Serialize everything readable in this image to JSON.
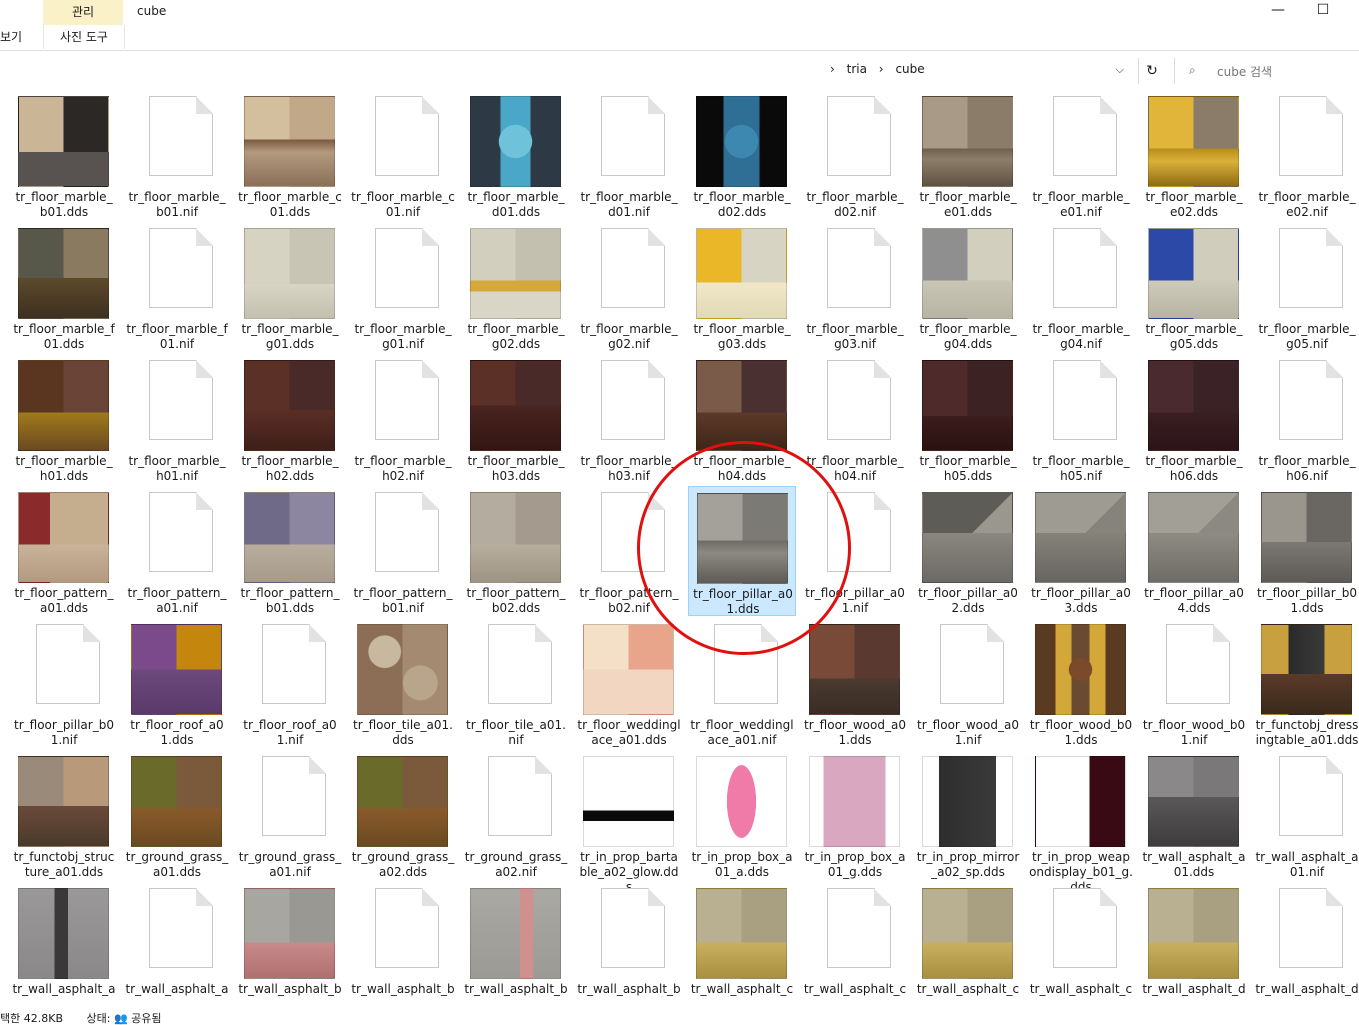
{
  "window": {
    "title": "cube",
    "minimize": "—",
    "maximize": "☐"
  },
  "ribbon": {
    "context_header": "관리",
    "context_tab": "사진 도구",
    "view_tab": "보기"
  },
  "address": {
    "crumbs": [
      "tria",
      "cube"
    ],
    "dropdown": "⌵",
    "refresh": "↻"
  },
  "search": {
    "placeholder": "cube 검색",
    "icon": "⌕"
  },
  "files": [
    {
      "name": "tr_floor_marble_b01.dds",
      "type": "img",
      "bg": "linear-gradient(to bottom,transparent 62%,#585250 62%),linear-gradient(to right,#cbb597 50%,#2c2825 50%)"
    },
    {
      "name": "tr_floor_marble_b01.nif",
      "type": "doc"
    },
    {
      "name": "tr_floor_marble_c01.dds",
      "type": "img",
      "bg": "linear-gradient(to bottom,transparent 48%,#7a5a40 48%,#b39a7e 62%,#8a7058 100%),linear-gradient(to right,#d3bf9e 50%,#c0a888 50%)"
    },
    {
      "name": "tr_floor_marble_c01.nif",
      "type": "doc"
    },
    {
      "name": "tr_floor_marble_d01.dds",
      "type": "img",
      "bg": "radial-gradient(circle at 50% 50%,#6ec3db 26%,transparent 27%),linear-gradient(to right,#2d3a45 33%,#4aa7c7 33%,#4aa7c7 67%,#2d3a45 67%)"
    },
    {
      "name": "tr_floor_marble_d01.nif",
      "type": "doc"
    },
    {
      "name": "tr_floor_marble_d02.dds",
      "type": "img",
      "bg": "radial-gradient(circle at 50% 50%,#3c88b0 26%,transparent 27%),linear-gradient(to right,#0a0a0a 30%,#2f6f95 30%,#2f6f95 70%,#0a0a0a 70%)"
    },
    {
      "name": "tr_floor_marble_d02.nif",
      "type": "doc"
    },
    {
      "name": "tr_floor_marble_e01.dds",
      "type": "img",
      "bg": "linear-gradient(to bottom,transparent 58%,#6e604e 58%,#8d7e6a 70%,#5e5242 100%),linear-gradient(to right,#a89a87 50%,#8a7c69 50%)"
    },
    {
      "name": "tr_floor_marble_e01.nif",
      "type": "doc"
    },
    {
      "name": "tr_floor_marble_e02.dds",
      "type": "img",
      "bg": "linear-gradient(to bottom,transparent 58%,#b88d1a 58%,#d9b13a 72%,#8e6c12 100%),linear-gradient(to right,#e0b53a 50%,#8a7c69 50%)"
    },
    {
      "name": "tr_floor_marble_e02.nif",
      "type": "doc"
    },
    {
      "name": "tr_floor_marble_f01.dds",
      "type": "img",
      "bg": "linear-gradient(to bottom,transparent 55%,#5d4a2c 55%,#3d3020 100%),linear-gradient(to right,#57574a 50%,#8a7a60 50%)"
    },
    {
      "name": "tr_floor_marble_f01.nif",
      "type": "doc"
    },
    {
      "name": "tr_floor_marble_g01.dds",
      "type": "img",
      "bg": "linear-gradient(to bottom,transparent 62%,#d8d5c6 62%,#c4c0b0 100%),linear-gradient(to right,#d6d3c3 50%,#c8c5b5 50%)"
    },
    {
      "name": "tr_floor_marble_g01.nif",
      "type": "doc"
    },
    {
      "name": "tr_floor_marble_g02.dds",
      "type": "img",
      "bg": "linear-gradient(to bottom,transparent 58%,#d4a83a 58%,#d4a83a 70%,#d9d6c7 70%),linear-gradient(to right,#d2cfbf 50%,#c3c0b0 50%)"
    },
    {
      "name": "tr_floor_marble_g02.nif",
      "type": "doc"
    },
    {
      "name": "tr_floor_marble_g03.dds",
      "type": "img",
      "bg": "linear-gradient(to bottom,transparent 60%,#f0e8c8 60%,#e2d9b5 100%),linear-gradient(to right,#e9b727 50%,#d8d4c3 50%)"
    },
    {
      "name": "tr_floor_marble_g03.nif",
      "type": "doc"
    },
    {
      "name": "tr_floor_marble_g04.dds",
      "type": "img",
      "bg": "linear-gradient(to bottom,transparent 58%,#c9c6b6 58%,#b8b4a3 100%),linear-gradient(to right,#8f8f8f 50%,#d2cfbf 50%)"
    },
    {
      "name": "tr_floor_marble_g04.nif",
      "type": "doc"
    },
    {
      "name": "tr_floor_marble_g05.dds",
      "type": "img",
      "bg": "linear-gradient(to bottom,transparent 58%,#cfcbbb 58%,#b8b4a3 100%),linear-gradient(to right,#2d49a8 50%,#d0cdbd 50%)"
    },
    {
      "name": "tr_floor_marble_g05.nif",
      "type": "doc"
    },
    {
      "name": "tr_floor_marble_h01.dds",
      "type": "img",
      "bg": "linear-gradient(to bottom,transparent 58%,#a07a1c 58%,#6b4a20 100%),linear-gradient(to right,#5a3520 50%,#6b4438 50%)"
    },
    {
      "name": "tr_floor_marble_h01.nif",
      "type": "doc"
    },
    {
      "name": "tr_floor_marble_h02.dds",
      "type": "img",
      "bg": "linear-gradient(to bottom,transparent 55%,#5a2e25 55%,#3e1f1a 100%),linear-gradient(to right,#5b3026 50%,#4a2a28 50%)"
    },
    {
      "name": "tr_floor_marble_h02.nif",
      "type": "doc"
    },
    {
      "name": "tr_floor_marble_h03.dds",
      "type": "img",
      "bg": "linear-gradient(to bottom,transparent 50%,#4a2420 50%,#321612 100%),linear-gradient(to right,#5b3026 50%,#4a2a28 50%)"
    },
    {
      "name": "tr_floor_marble_h03.nif",
      "type": "doc"
    },
    {
      "name": "tr_floor_marble_h04.dds",
      "type": "img",
      "bg": "linear-gradient(to bottom,transparent 58%,#5c3a28 58%,#3e2618 100%),linear-gradient(to right,#7a5a48 50%,#4a3030 50%)"
    },
    {
      "name": "tr_floor_marble_h04.nif",
      "type": "doc"
    },
    {
      "name": "tr_floor_marble_h05.dds",
      "type": "img",
      "bg": "linear-gradient(to bottom,transparent 62%,#3c1c1c 62%,#2a1212 100%),linear-gradient(to right,#4e2a2a 50%,#3c2222 50%)"
    },
    {
      "name": "tr_floor_marble_h05.nif",
      "type": "doc"
    },
    {
      "name": "tr_floor_marble_h06.dds",
      "type": "img",
      "bg": "linear-gradient(to bottom,transparent 58%,#3a1e22 58%,#2a1418 100%),linear-gradient(to right,#4a2a2e 50%,#3a2226 50%)"
    },
    {
      "name": "tr_floor_marble_h06.nif",
      "type": "doc"
    },
    {
      "name": "tr_floor_pattern_a01.dds",
      "type": "img",
      "bg": "linear-gradient(to bottom,transparent 58%,#c9b39a 58%,#b29a80 100%),linear-gradient(to right,#8a2a2a 35%,#c5ae8e 35%)"
    },
    {
      "name": "tr_floor_pattern_a01.nif",
      "type": "doc"
    },
    {
      "name": "tr_floor_pattern_b01.dds",
      "type": "img",
      "bg": "linear-gradient(to bottom,transparent 58%,#b9ad9d 58%,#a69a8a 100%),linear-gradient(to right,#6e6a88 50%,#8c86a0 50%)"
    },
    {
      "name": "tr_floor_pattern_b01.nif",
      "type": "doc"
    },
    {
      "name": "tr_floor_pattern_b02.dds",
      "type": "img",
      "bg": "linear-gradient(to bottom,transparent 58%,#b8ae9f 58%,#9e9484 100%),linear-gradient(to right,#b5aca0 50%,#a49a8e 50%)"
    },
    {
      "name": "tr_floor_pattern_b02.nif",
      "type": "doc"
    },
    {
      "name": "tr_floor_pillar_a01.dds",
      "type": "img",
      "selected": true,
      "bg": "linear-gradient(to bottom,transparent 52%,#6e6b65 52%,#8c8982 66%,#5e5b55 100%),linear-gradient(to right,#a4a19a 50%,#7c7a74 50%)"
    },
    {
      "name": "tr_floor_pillar_a01.nif",
      "type": "doc"
    },
    {
      "name": "tr_floor_pillar_a02.dds",
      "type": "img",
      "bg": "linear-gradient(to bottom,transparent 45%,#8a8780 45%,#6c6a64 100%),linear-gradient(135deg,#5e5c56 50%,#9a978f 50%)"
    },
    {
      "name": "tr_floor_pillar_a03.dds",
      "type": "img",
      "bg": "linear-gradient(to bottom,transparent 45%,#858279 45%,#676560 100%),linear-gradient(135deg,#9e9b93 50%,#86837c 50%)"
    },
    {
      "name": "tr_floor_pillar_a04.dds",
      "type": "img",
      "bg": "linear-gradient(to bottom,transparent 45%,#8e8b83 45%,#6e6c66 100%),linear-gradient(135deg,#a29f97 50%,#8c8982 50%)"
    },
    {
      "name": "tr_floor_pillar_b01.dds",
      "type": "img",
      "bg": "linear-gradient(to bottom,transparent 55%,#7c7872 55%,#5e5b56 100%),linear-gradient(to right,#9a968e 50%,#6a6762 50%)"
    },
    {
      "name": "tr_floor_pillar_b01.nif",
      "type": "doc"
    },
    {
      "name": "tr_floor_roof_a01.dds",
      "type": "img",
      "bg": "linear-gradient(to bottom,transparent 50%,#6c4a7c 50%,#5a3a6a 100%),linear-gradient(to right,#7a4a8a 50%,#c5860e 50%)"
    },
    {
      "name": "tr_floor_roof_a01.nif",
      "type": "doc"
    },
    {
      "name": "tr_floor_tile_a01.dds",
      "type": "img",
      "bg": "radial-gradient(circle at 30% 30%,#c9b8a0 18%,transparent 19%),radial-gradient(circle at 70% 65%,#b8a58c 20%,transparent 21%),linear-gradient(to right,#8b6e55 50%,#a38a70 50%)"
    },
    {
      "name": "tr_floor_tile_a01.nif",
      "type": "doc"
    },
    {
      "name": "tr_floor_weddinglace_a01.dds",
      "type": "img",
      "bg": "linear-gradient(to bottom,transparent 50%,#f2d6c2 50%),linear-gradient(to right,#f3e0c6 50%,#e8a58c 50%)"
    },
    {
      "name": "tr_floor_weddinglace_a01.nif",
      "type": "doc"
    },
    {
      "name": "tr_floor_wood_a01.dds",
      "type": "img",
      "bg": "linear-gradient(to bottom,transparent 60%,#4a3a30 60%,#3a2c24 100%),linear-gradient(to right,#7a4a38 50%,#5a3a30 50%)"
    },
    {
      "name": "tr_floor_wood_a01.nif",
      "type": "doc"
    },
    {
      "name": "tr_floor_wood_b01.dds",
      "type": "img",
      "bg": "radial-gradient(circle at 50% 50%,#7a4a2a 18%,transparent 19%),linear-gradient(to right,#5a3a20 22%,#d4a838 22%,#d4a838 40%,#6a4a30 40%,#6a4a30 60%,#d4a838 60%,#d4a838 78%,#5a3a20 78%)"
    },
    {
      "name": "tr_floor_wood_b01.nif",
      "type": "doc"
    },
    {
      "name": "tr_functobj_dressingtable_a01.dds",
      "type": "img",
      "bg": "linear-gradient(to bottom,transparent 55%,#5a3a2a 55%,#3a2a1a 100%),linear-gradient(to right,#c9a040 30%,#2a2a2a 30%,#3a3a3a 70%,#c9a040 70%)"
    },
    {
      "name": "tr_functobj_structure_a01.dds",
      "type": "img",
      "bg": "linear-gradient(to bottom,transparent 55%,#6a4a3a 55%,#4a3a2a 100%),linear-gradient(to right,#9a8a7a 50%,#b89a7a 50%)"
    },
    {
      "name": "tr_ground_grass_a01.dds",
      "type": "img",
      "bg": "linear-gradient(to bottom,transparent 58%,#8a5a2a 58%,#6a4a22 100%),linear-gradient(to right,#6a6a2a 50%,#7a5a3a 50%)"
    },
    {
      "name": "tr_ground_grass_a01.nif",
      "type": "doc"
    },
    {
      "name": "tr_ground_grass_a02.dds",
      "type": "img",
      "bg": "linear-gradient(to bottom,transparent 58%,#8a5a2a 58%,#6a4a22 100%),linear-gradient(to right,#6a6a2a 50%,#7a5a3a 50%)"
    },
    {
      "name": "tr_ground_grass_a02.nif",
      "type": "doc"
    },
    {
      "name": "tr_in_prop_bartable_a02_glow.dds",
      "type": "img",
      "bg": "linear-gradient(to bottom,transparent 60%,#0a0a0a 60%,#0a0a0a 72%,transparent 72%),linear-gradient(#ffffff,#ffffff)"
    },
    {
      "name": "tr_in_prop_box_a01_a.dds",
      "type": "img",
      "bg": "radial-gradient(ellipse 18% 45% at 50% 50%,#f07aa8 90%,transparent 92%),linear-gradient(#ffffff,#ffffff)"
    },
    {
      "name": "tr_in_prop_box_a01_g.dds",
      "type": "img",
      "bg": "linear-gradient(to right,transparent 15%,#d9a8c0 15%,#d9a8c0 85%,transparent 85%),linear-gradient(#ffffff,#ffffff)"
    },
    {
      "name": "tr_in_prop_mirror_a02_sp.dds",
      "type": "img",
      "bg": "linear-gradient(to right,transparent 18%,#2e2e2e 18%,#3a3a3a 82%,transparent 82%),linear-gradient(#ffffff,#ffffff)"
    },
    {
      "name": "tr_in_prop_weapondisplay_b01_g.dds",
      "type": "img",
      "bg": "linear-gradient(to right,transparent 60%,#3a0a14 60%),linear-gradient(to bottom,#ffffff 60%,#ffffff 60%)"
    },
    {
      "name": "tr_wall_asphalt_a01.dds",
      "type": "img",
      "bg": "linear-gradient(to bottom,transparent 45%,#5a5858 45%,#3e3c3c 100%),linear-gradient(to right,#8a8888 50%,#7a7878 50%)"
    },
    {
      "name": "tr_wall_asphalt_a01.nif",
      "type": "doc"
    },
    {
      "name": "tr_wall_asphalt_a",
      "type": "img",
      "bg": "linear-gradient(to right,transparent 40%,#3a3838 40%,#3a3838 55%,transparent 55%),linear-gradient(to bottom,#9a9898,#8a8888)"
    },
    {
      "name": "tr_wall_asphalt_a",
      "type": "doc"
    },
    {
      "name": "tr_wall_asphalt_b",
      "type": "img",
      "bg": "linear-gradient(to bottom,transparent 60%,#c88a8a 60%,#b07070 100%),linear-gradient(to right,#a8a6a0 50%,#9a9892 50%)"
    },
    {
      "name": "tr_wall_asphalt_b",
      "type": "doc"
    },
    {
      "name": "tr_wall_asphalt_b",
      "type": "img",
      "bg": "linear-gradient(to right,transparent 55%,#d09090 55%,#d09090 70%,transparent 70%),linear-gradient(to bottom,#aaa8a2,#9c9a94)"
    },
    {
      "name": "tr_wall_asphalt_b",
      "type": "doc"
    },
    {
      "name": "tr_wall_asphalt_c",
      "type": "img",
      "bg": "linear-gradient(to bottom,transparent 60%,#c8b060 60%,#a89040 100%),linear-gradient(to right,#b8b090 50%,#a8a080 50%)"
    },
    {
      "name": "tr_wall_asphalt_c",
      "type": "doc"
    },
    {
      "name": "tr_wall_asphalt_c",
      "type": "img",
      "bg": "linear-gradient(to bottom,transparent 60%,#c8b060 60%,#a89040 100%),linear-gradient(to right,#b8b090 50%,#a8a080 50%)"
    },
    {
      "name": "tr_wall_asphalt_c",
      "type": "doc"
    },
    {
      "name": "tr_wall_asphalt_d",
      "type": "img",
      "bg": "linear-gradient(to bottom,transparent 60%,#c8b060 60%,#a89040 100%),linear-gradient(to right,#b8b090 50%,#a8a080 50%)"
    },
    {
      "name": "tr_wall_asphalt_d",
      "type": "doc"
    }
  ],
  "status": {
    "selection": "택한 42.8KB",
    "state": "상태: 👥 공유됨"
  },
  "annotation_color": "#e01010"
}
